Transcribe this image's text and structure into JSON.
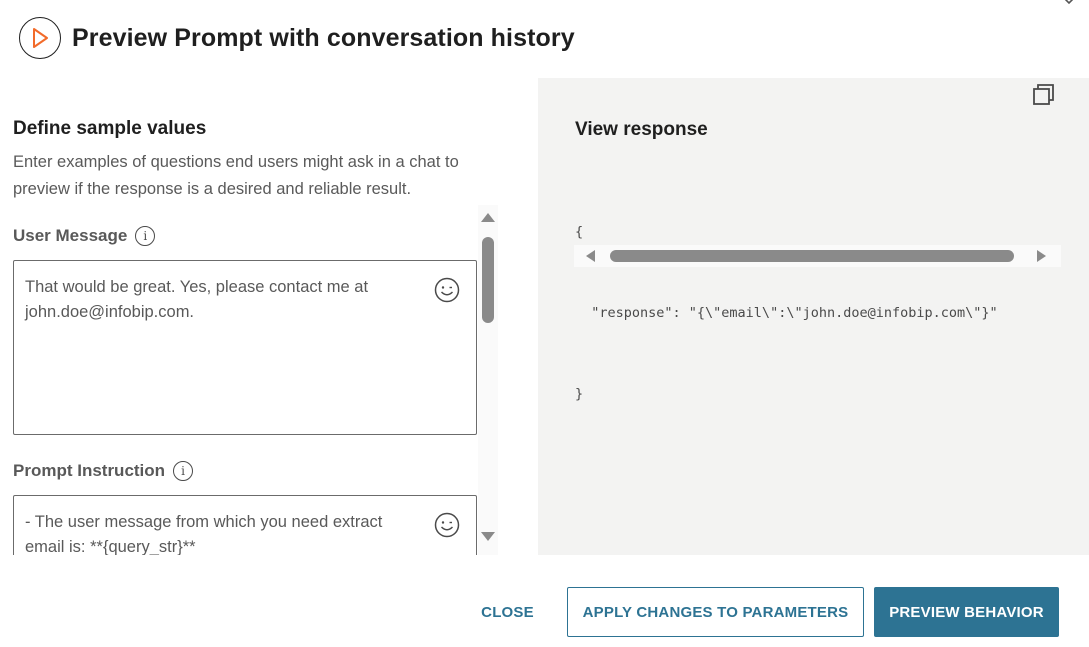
{
  "dialog": {
    "title": "Preview Prompt with conversation history",
    "icons": {
      "header": "play-circle-icon",
      "close": "close-icon",
      "copy": "copy-icon"
    }
  },
  "left_panel": {
    "section_title": "Define sample values",
    "description": "Enter examples of questions end users might ask in a chat to preview if the response is a desired and reliable result.",
    "fields": [
      {
        "label": "User Message",
        "value": "That would be great. Yes, please contact me at john.doe@infobip.com."
      },
      {
        "label": "Prompt Instruction",
        "value": "- The user message from which you need extract email is: **{query_str}**"
      }
    ]
  },
  "right_panel": {
    "title": "View response",
    "code_lines": [
      "{",
      "  \"response\": \"{\\\"email\\\":\\\"john.doe@infobip.com\\\"}\"",
      "}"
    ]
  },
  "footer": {
    "close_label": "CLOSE",
    "apply_label": "APPLY CHANGES TO PARAMETERS",
    "preview_label": "PREVIEW BEHAVIOR"
  },
  "colors": {
    "primary": "#2d7393",
    "accent_play": "#f26b2a",
    "response_bg": "#f3f3f2"
  }
}
